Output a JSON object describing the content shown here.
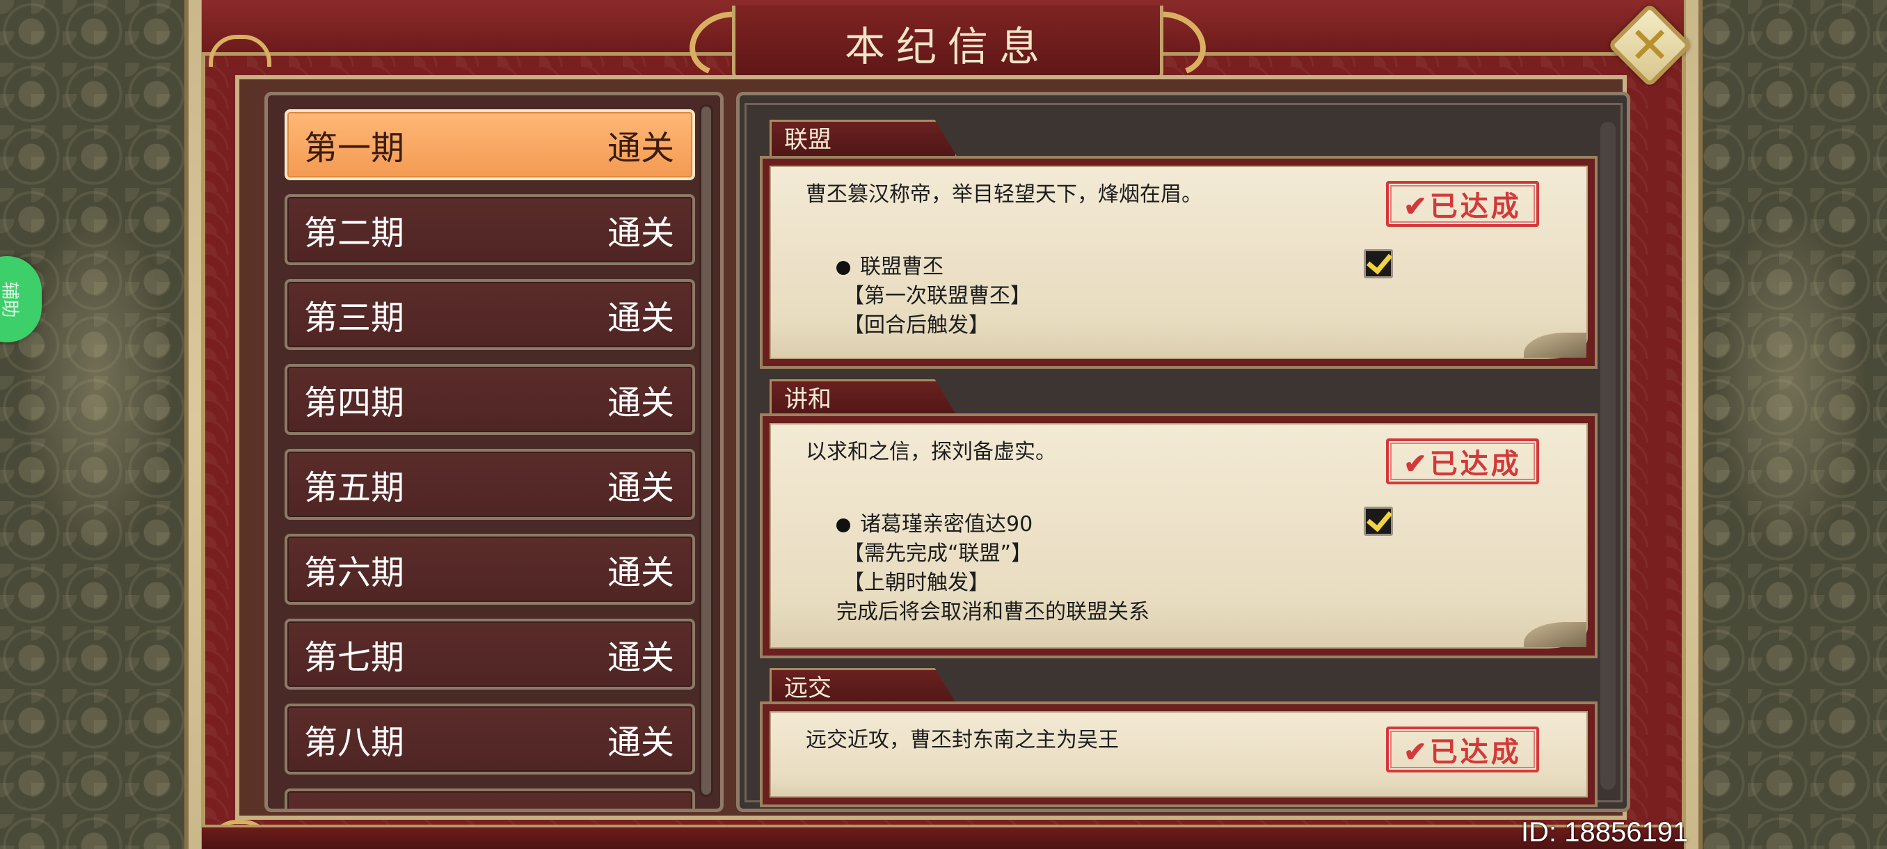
{
  "title": "本纪信息",
  "side_tab_text": "辅助",
  "close_label": "✕",
  "periods": [
    {
      "name": "第一期",
      "status": "通关",
      "active": true
    },
    {
      "name": "第二期",
      "status": "通关",
      "active": false
    },
    {
      "name": "第三期",
      "status": "通关",
      "active": false
    },
    {
      "name": "第四期",
      "status": "通关",
      "active": false
    },
    {
      "name": "第五期",
      "status": "通关",
      "active": false
    },
    {
      "name": "第六期",
      "status": "通关",
      "active": false
    },
    {
      "name": "第七期",
      "status": "通关",
      "active": false
    },
    {
      "name": "第八期",
      "status": "通关",
      "active": false
    }
  ],
  "sections": [
    {
      "tab": "联盟",
      "intro": "曹丕篡汉称帝，举目轻望天下，烽烟在眉。",
      "stamp": "✔已达成",
      "conditions": [
        "联盟曹丕"
      ],
      "notes": [
        "【第一次联盟曹丕】",
        "【回合后触发】"
      ],
      "checked": true
    },
    {
      "tab": "讲和",
      "intro": "以求和之信，探刘备虚实。",
      "stamp": "✔已达成",
      "conditions": [
        "诸葛瑾亲密值达90"
      ],
      "notes": [
        "【需先完成“联盟”】",
        "【上朝时触发】",
        "完成后将会取消和曹丕的联盟关系"
      ],
      "checked": true
    },
    {
      "tab": "远交",
      "intro": "远交近攻，曹丕封东南之主为吴王",
      "stamp": "✔已达成",
      "conditions": [],
      "notes": [],
      "checked": false
    }
  ],
  "footer": {
    "id_text": "ID: 18856191"
  },
  "colors": {
    "accent_orange": "#f39a52",
    "stamp_red": "#d23a3a",
    "frame_red": "#6e1b1b",
    "check_yellow": "#f2d440"
  }
}
